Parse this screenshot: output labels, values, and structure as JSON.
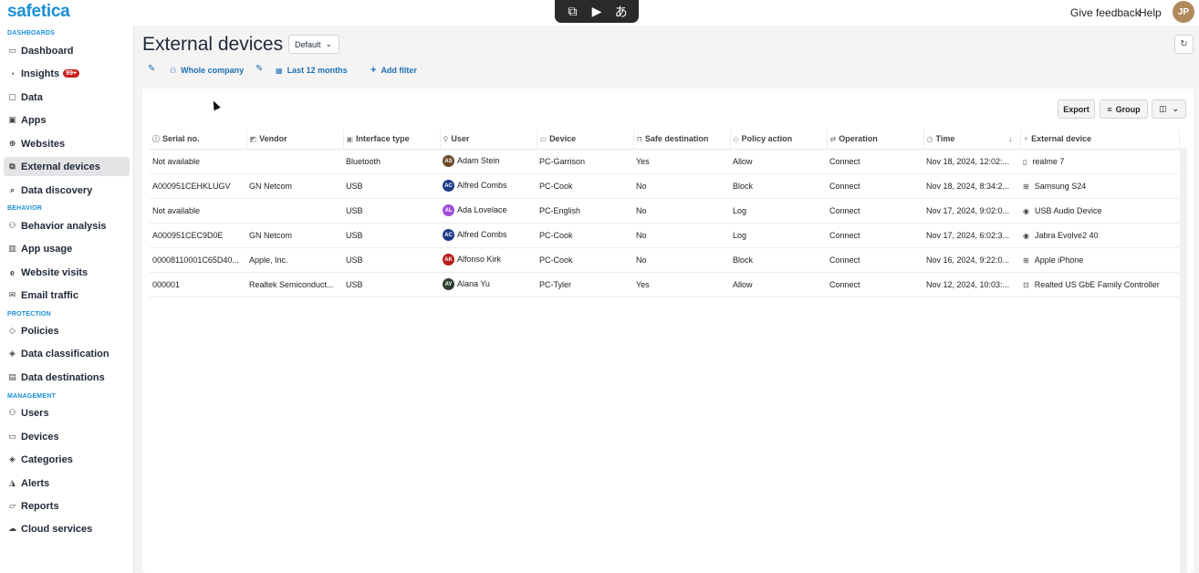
{
  "app": {
    "logo": "safetica"
  },
  "overlay": {
    "icons": [
      "window-switch-icon",
      "screen-record-icon",
      "translate-icon"
    ]
  },
  "topbar": {
    "feedback": "Give feedback",
    "help": "Help",
    "avatar": "JP"
  },
  "sidebar": {
    "sections": {
      "dashboards": "DASHBOARDS",
      "behavior": "BEHAVIOR",
      "protection": "PROTECTION",
      "management": "MANAGEMENT"
    },
    "items": [
      {
        "label": "Dashboard",
        "icon": "dashboard-icon"
      },
      {
        "label": "Insights",
        "icon": "bell-icon",
        "badge": "99+"
      },
      {
        "label": "Data",
        "icon": "file-icon"
      },
      {
        "label": "Apps",
        "icon": "apps-icon"
      },
      {
        "label": "Websites",
        "icon": "globe-icon"
      },
      {
        "label": "External devices",
        "icon": "devices-icon",
        "active": true
      },
      {
        "label": "Data discovery",
        "icon": "search-icon"
      },
      {
        "label": "Behavior analysis",
        "icon": "people-icon"
      },
      {
        "label": "App usage",
        "icon": "chart-icon"
      },
      {
        "label": "Website visits",
        "icon": "edge-icon"
      },
      {
        "label": "Email traffic",
        "icon": "mail-icon"
      },
      {
        "label": "Policies",
        "icon": "shield-icon"
      },
      {
        "label": "Data classification",
        "icon": "tag-icon"
      },
      {
        "label": "Data destinations",
        "icon": "destination-icon"
      },
      {
        "label": "Users",
        "icon": "users-icon"
      },
      {
        "label": "Devices",
        "icon": "laptop-icon"
      },
      {
        "label": "Categories",
        "icon": "tag-icon"
      },
      {
        "label": "Alerts",
        "icon": "alert-icon"
      },
      {
        "label": "Reports",
        "icon": "report-icon"
      },
      {
        "label": "Cloud services",
        "icon": "cloud-icon"
      }
    ]
  },
  "header": {
    "title": "External devices",
    "view": "Default"
  },
  "filters": {
    "scope": "Whole company",
    "period": "Last 12 months",
    "add": "Add filter"
  },
  "toolbar": {
    "export": "Export",
    "group": "Group"
  },
  "table": {
    "columns": [
      "Serial no.",
      "Vendor",
      "Interface type",
      "User",
      "Device",
      "Safe destination",
      "Policy action",
      "Operation",
      "Time",
      "External device"
    ],
    "rows": [
      {
        "serial": "Not available",
        "vendor": "",
        "iface": "Bluetooth",
        "initials": "AS",
        "user": "Adam Stein",
        "color": "#6b4a2b",
        "device": "PC-Garrison",
        "safe": "Yes",
        "policy": "Allow",
        "op": "Connect",
        "time": "Nov 18, 2024, 12:02:...",
        "ext_icon": "phone-icon",
        "ext": "realme 7"
      },
      {
        "serial": "A000951CEHKLUGV",
        "vendor": "GN Netcom",
        "iface": "USB",
        "initials": "AC",
        "user": "Alfred Combs",
        "color": "#1e3a8a",
        "device": "PC-Cook",
        "safe": "No",
        "policy": "Block",
        "op": "Connect",
        "time": "Nov 18, 2024, 8:34:2...",
        "ext_icon": "grid-icon",
        "ext": "Samsung S24"
      },
      {
        "serial": "Not available",
        "vendor": "",
        "iface": "USB",
        "initials": "AL",
        "user": "Ada Lovelace",
        "color": "#9d4edd",
        "device": "PC-English",
        "safe": "No",
        "policy": "Log",
        "op": "Connect",
        "time": "Nov 17, 2024, 9:02:0...",
        "ext_icon": "audio-icon",
        "ext": "USB Audio Device"
      },
      {
        "serial": "A000951CEC9D0E",
        "vendor": "GN Netcom",
        "iface": "USB",
        "initials": "AC",
        "user": "Alfred Combs",
        "color": "#1e3a8a",
        "device": "PC-Cook",
        "safe": "No",
        "policy": "Log",
        "op": "Connect",
        "time": "Nov 17, 2024, 6:02:3...",
        "ext_icon": "audio-icon",
        "ext": "Jabra Evolve2 40"
      },
      {
        "serial": "00008110001C65D40...",
        "vendor": "Apple, Inc.",
        "iface": "USB",
        "initials": "AK",
        "user": "Alfonso Kirk",
        "color": "#b91c1c",
        "device": "PC-Cook",
        "safe": "No",
        "policy": "Block",
        "op": "Connect",
        "time": "Nov 16, 2024, 9:22:0...",
        "ext_icon": "grid-icon",
        "ext": "Apple iPhone"
      },
      {
        "serial": "000001",
        "vendor": "Realtek Semiconduct...",
        "iface": "USB",
        "initials": "AY",
        "user": "Alana Yu",
        "color": "#2f3e2f",
        "device": "PC-Tyler",
        "safe": "Yes",
        "policy": "Allow",
        "op": "Connect",
        "time": "Nov 12, 2024, 10:03:...",
        "ext_icon": "chip-icon",
        "ext": "Realted US GbE Family Controller"
      }
    ]
  }
}
